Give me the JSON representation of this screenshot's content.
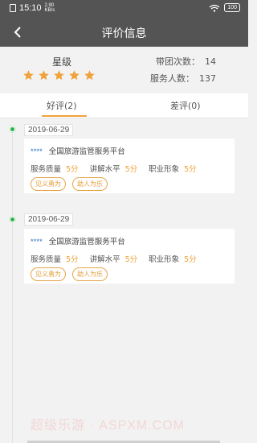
{
  "status_bar": {
    "time": "15:10",
    "speed": "2.90\nKB/s",
    "battery": "100"
  },
  "nav": {
    "title": "评价信息"
  },
  "summary": {
    "star_label": "星级",
    "rating_stars": 5,
    "trips_label": "带团次数：",
    "trips_value": "14",
    "served_label": "服务人数：",
    "served_value": "137"
  },
  "tabs": [
    {
      "label": "好评(2)",
      "active": true
    },
    {
      "label": "差评(0)",
      "active": false
    }
  ],
  "reviews": [
    {
      "date": "2019-06-29",
      "user": "****",
      "source": "全国旅游监管服务平台",
      "scores": [
        {
          "label": "服务质量",
          "value": "5分"
        },
        {
          "label": "讲解水平",
          "value": "5分"
        },
        {
          "label": "职业形象",
          "value": "5分"
        }
      ],
      "tags": [
        "见义勇为",
        "助人为乐"
      ]
    },
    {
      "date": "2019-06-29",
      "user": "****",
      "source": "全国旅游监管服务平台",
      "scores": [
        {
          "label": "服务质量",
          "value": "5分"
        },
        {
          "label": "讲解水平",
          "value": "5分"
        },
        {
          "label": "职业形象",
          "value": "5分"
        }
      ],
      "tags": [
        "见义勇为",
        "助人为乐"
      ]
    }
  ],
  "watermark": "超级乐游 · ASPXM.COM",
  "colors": {
    "header": "#545454",
    "accent": "#f0a23b",
    "timeline_dot": "#2bb14b",
    "user_mask": "#2d74c4"
  }
}
